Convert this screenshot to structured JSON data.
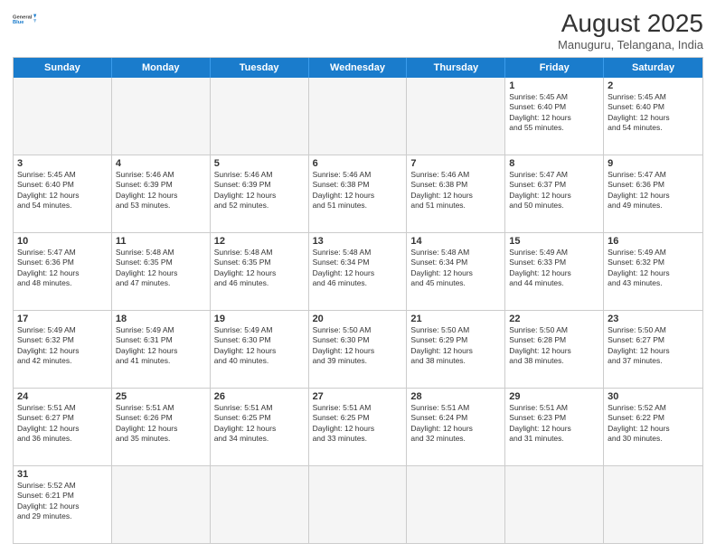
{
  "logo": {
    "text_general": "General",
    "text_blue": "Blue"
  },
  "title": "August 2025",
  "subtitle": "Manuguru, Telangana, India",
  "header_days": [
    "Sunday",
    "Monday",
    "Tuesday",
    "Wednesday",
    "Thursday",
    "Friday",
    "Saturday"
  ],
  "rows": [
    [
      {
        "date": "",
        "info": ""
      },
      {
        "date": "",
        "info": ""
      },
      {
        "date": "",
        "info": ""
      },
      {
        "date": "",
        "info": ""
      },
      {
        "date": "",
        "info": ""
      },
      {
        "date": "1",
        "info": "Sunrise: 5:45 AM\nSunset: 6:40 PM\nDaylight: 12 hours\nand 55 minutes."
      },
      {
        "date": "2",
        "info": "Sunrise: 5:45 AM\nSunset: 6:40 PM\nDaylight: 12 hours\nand 54 minutes."
      }
    ],
    [
      {
        "date": "3",
        "info": "Sunrise: 5:45 AM\nSunset: 6:40 PM\nDaylight: 12 hours\nand 54 minutes."
      },
      {
        "date": "4",
        "info": "Sunrise: 5:46 AM\nSunset: 6:39 PM\nDaylight: 12 hours\nand 53 minutes."
      },
      {
        "date": "5",
        "info": "Sunrise: 5:46 AM\nSunset: 6:39 PM\nDaylight: 12 hours\nand 52 minutes."
      },
      {
        "date": "6",
        "info": "Sunrise: 5:46 AM\nSunset: 6:38 PM\nDaylight: 12 hours\nand 51 minutes."
      },
      {
        "date": "7",
        "info": "Sunrise: 5:46 AM\nSunset: 6:38 PM\nDaylight: 12 hours\nand 51 minutes."
      },
      {
        "date": "8",
        "info": "Sunrise: 5:47 AM\nSunset: 6:37 PM\nDaylight: 12 hours\nand 50 minutes."
      },
      {
        "date": "9",
        "info": "Sunrise: 5:47 AM\nSunset: 6:36 PM\nDaylight: 12 hours\nand 49 minutes."
      }
    ],
    [
      {
        "date": "10",
        "info": "Sunrise: 5:47 AM\nSunset: 6:36 PM\nDaylight: 12 hours\nand 48 minutes."
      },
      {
        "date": "11",
        "info": "Sunrise: 5:48 AM\nSunset: 6:35 PM\nDaylight: 12 hours\nand 47 minutes."
      },
      {
        "date": "12",
        "info": "Sunrise: 5:48 AM\nSunset: 6:35 PM\nDaylight: 12 hours\nand 46 minutes."
      },
      {
        "date": "13",
        "info": "Sunrise: 5:48 AM\nSunset: 6:34 PM\nDaylight: 12 hours\nand 46 minutes."
      },
      {
        "date": "14",
        "info": "Sunrise: 5:48 AM\nSunset: 6:34 PM\nDaylight: 12 hours\nand 45 minutes."
      },
      {
        "date": "15",
        "info": "Sunrise: 5:49 AM\nSunset: 6:33 PM\nDaylight: 12 hours\nand 44 minutes."
      },
      {
        "date": "16",
        "info": "Sunrise: 5:49 AM\nSunset: 6:32 PM\nDaylight: 12 hours\nand 43 minutes."
      }
    ],
    [
      {
        "date": "17",
        "info": "Sunrise: 5:49 AM\nSunset: 6:32 PM\nDaylight: 12 hours\nand 42 minutes."
      },
      {
        "date": "18",
        "info": "Sunrise: 5:49 AM\nSunset: 6:31 PM\nDaylight: 12 hours\nand 41 minutes."
      },
      {
        "date": "19",
        "info": "Sunrise: 5:49 AM\nSunset: 6:30 PM\nDaylight: 12 hours\nand 40 minutes."
      },
      {
        "date": "20",
        "info": "Sunrise: 5:50 AM\nSunset: 6:30 PM\nDaylight: 12 hours\nand 39 minutes."
      },
      {
        "date": "21",
        "info": "Sunrise: 5:50 AM\nSunset: 6:29 PM\nDaylight: 12 hours\nand 38 minutes."
      },
      {
        "date": "22",
        "info": "Sunrise: 5:50 AM\nSunset: 6:28 PM\nDaylight: 12 hours\nand 38 minutes."
      },
      {
        "date": "23",
        "info": "Sunrise: 5:50 AM\nSunset: 6:27 PM\nDaylight: 12 hours\nand 37 minutes."
      }
    ],
    [
      {
        "date": "24",
        "info": "Sunrise: 5:51 AM\nSunset: 6:27 PM\nDaylight: 12 hours\nand 36 minutes."
      },
      {
        "date": "25",
        "info": "Sunrise: 5:51 AM\nSunset: 6:26 PM\nDaylight: 12 hours\nand 35 minutes."
      },
      {
        "date": "26",
        "info": "Sunrise: 5:51 AM\nSunset: 6:25 PM\nDaylight: 12 hours\nand 34 minutes."
      },
      {
        "date": "27",
        "info": "Sunrise: 5:51 AM\nSunset: 6:25 PM\nDaylight: 12 hours\nand 33 minutes."
      },
      {
        "date": "28",
        "info": "Sunrise: 5:51 AM\nSunset: 6:24 PM\nDaylight: 12 hours\nand 32 minutes."
      },
      {
        "date": "29",
        "info": "Sunrise: 5:51 AM\nSunset: 6:23 PM\nDaylight: 12 hours\nand 31 minutes."
      },
      {
        "date": "30",
        "info": "Sunrise: 5:52 AM\nSunset: 6:22 PM\nDaylight: 12 hours\nand 30 minutes."
      }
    ],
    [
      {
        "date": "31",
        "info": "Sunrise: 5:52 AM\nSunset: 6:21 PM\nDaylight: 12 hours\nand 29 minutes."
      },
      {
        "date": "",
        "info": ""
      },
      {
        "date": "",
        "info": ""
      },
      {
        "date": "",
        "info": ""
      },
      {
        "date": "",
        "info": ""
      },
      {
        "date": "",
        "info": ""
      },
      {
        "date": "",
        "info": ""
      }
    ]
  ]
}
